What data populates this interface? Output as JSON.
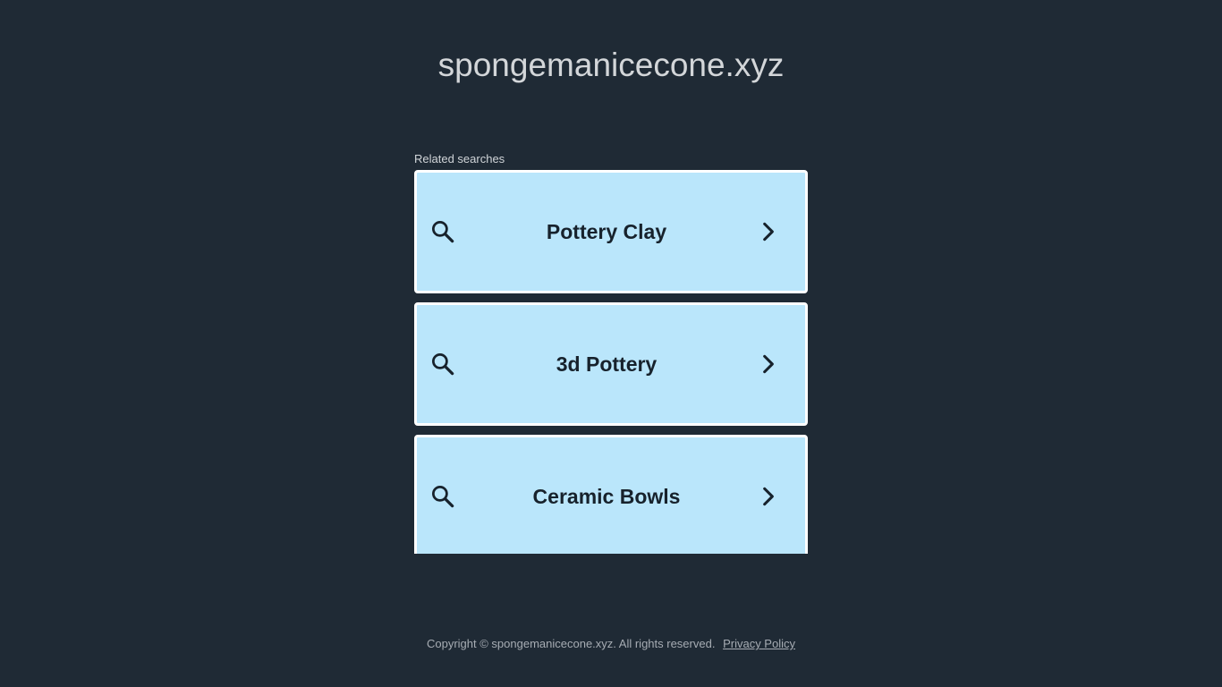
{
  "site": {
    "domain": "spongemanicecone.xyz"
  },
  "related": {
    "label": "Related searches",
    "items": [
      {
        "label": "Pottery Clay"
      },
      {
        "label": "3d Pottery"
      },
      {
        "label": "Ceramic Bowls"
      }
    ],
    "icons": {
      "left": "search-icon",
      "right": "chevron-right-icon"
    }
  },
  "footer": {
    "copyright": "Copyright © spongemanicecone.xyz.  All rights reserved.",
    "privacy_label": "Privacy Policy"
  },
  "colors": {
    "background": "#1f2a35",
    "card_background": "#bae6fb",
    "card_border": "#ffffff",
    "card_text": "#17222c",
    "title_text": "#d3d6d9"
  }
}
